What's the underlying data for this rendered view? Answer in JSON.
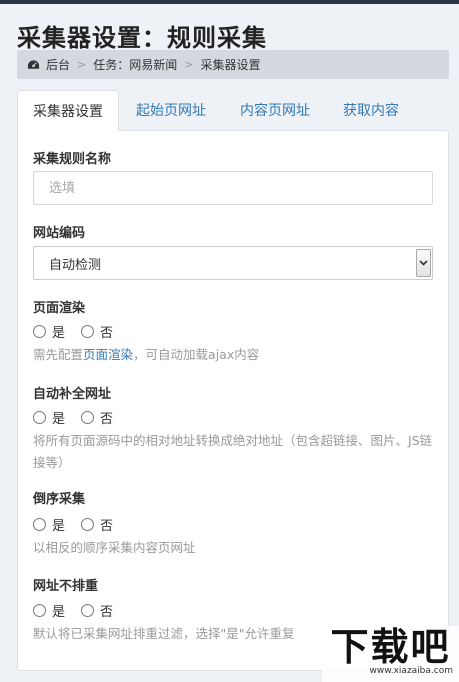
{
  "page": {
    "title": "采集器设置：规则采集"
  },
  "breadcrumb": {
    "home": "后台",
    "task": "任务：网易新闻",
    "current": "采集器设置",
    "sep": ">"
  },
  "tabs": [
    {
      "label": "采集器设置"
    },
    {
      "label": "起始页网址"
    },
    {
      "label": "内容页网址"
    },
    {
      "label": "获取内容"
    }
  ],
  "form": {
    "rule_name": {
      "label": "采集规则名称",
      "placeholder": "选填"
    },
    "encoding": {
      "label": "网站编码",
      "value": "自动检测"
    },
    "render": {
      "label": "页面渲染",
      "yes": "是",
      "no": "否",
      "help_prefix": "需先配置",
      "help_link": "页面渲染",
      "help_suffix": "，可自动加载ajax内容"
    },
    "complete_url": {
      "label": "自动补全网址",
      "yes": "是",
      "no": "否",
      "help": "将所有页面源码中的相对地址转换成绝对地址（包含超链接、图片、JS链接等）"
    },
    "reverse": {
      "label": "倒序采集",
      "yes": "是",
      "no": "否",
      "help": "以相反的顺序采集内容页网址"
    },
    "dedupe": {
      "label": "网址不排重",
      "yes": "是",
      "no": "否",
      "help": "默认将已采集网址排重过滤，选择\"是\"允许重复"
    }
  },
  "watermark": {
    "text": "下载吧",
    "url": "www.xiazaiba.com"
  }
}
